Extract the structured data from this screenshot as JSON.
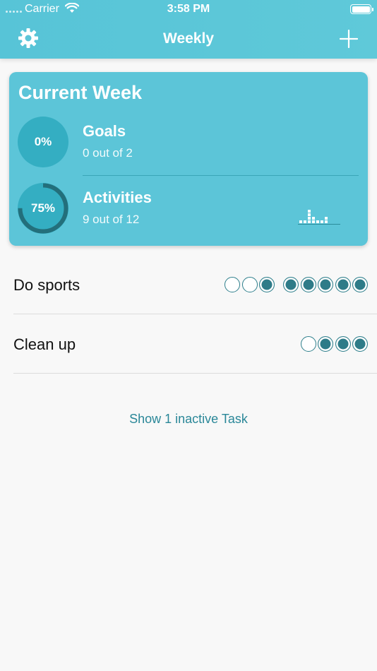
{
  "status_bar": {
    "carrier": "Carrier",
    "time": "3:58 PM",
    "battery_level": 1.0
  },
  "nav": {
    "title": "Weekly",
    "left_icon": "gear-icon",
    "right_icon": "plus-icon"
  },
  "colors": {
    "bar": "#5cc5d8",
    "ring_bg": "#34aec2",
    "ring_progress": "#236f7b",
    "dot_done": "#2e7b88",
    "link": "#2a8798"
  },
  "summary": {
    "title": "Current Week",
    "goals": {
      "percent_label": "0%",
      "progress": 0.0,
      "label": "Goals",
      "detail": "0 out of 2"
    },
    "activities": {
      "percent_label": "75%",
      "progress": 0.75,
      "label": "Activities",
      "detail": "9 out of 12"
    },
    "mini_chart_levels": [
      1,
      1,
      4,
      2,
      1,
      1,
      2
    ]
  },
  "tasks": [
    {
      "name": "Do sports",
      "groups": [
        [
          false,
          false,
          true
        ],
        [
          true,
          true,
          true,
          true,
          true
        ]
      ]
    },
    {
      "name": "Clean up",
      "groups": [
        [
          false,
          true,
          true,
          true
        ]
      ]
    }
  ],
  "footer": {
    "show_inactive": "Show 1 inactive Task"
  }
}
